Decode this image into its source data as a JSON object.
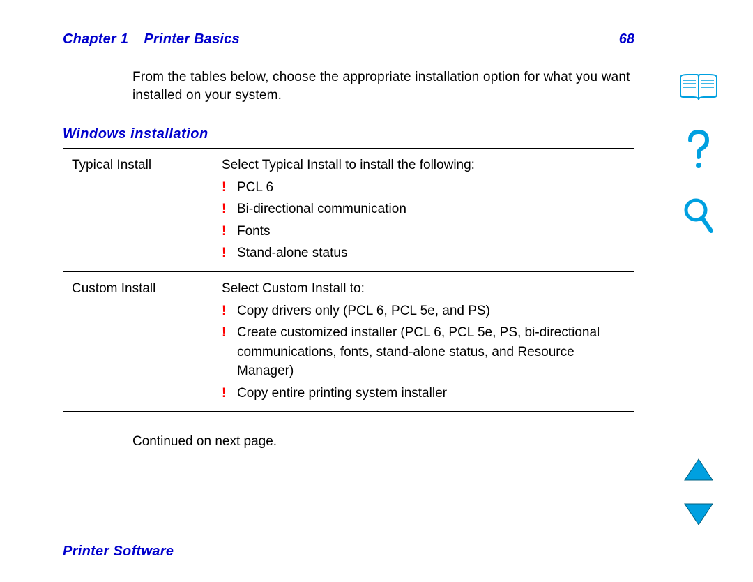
{
  "header": {
    "chapter_label": "Chapter 1",
    "chapter_title": "Printer Basics",
    "page_number": "68"
  },
  "intro": "From the tables below, choose the appropriate installation option for what you want installed on your system.",
  "section_heading": "Windows installation",
  "table": {
    "rows": [
      {
        "left": "Typical Install",
        "lead": "Select Typical Install  to install the following:",
        "bullets": [
          "PCL 6",
          "Bi-directional communication",
          "Fonts",
          "Stand-alone status"
        ]
      },
      {
        "left": "Custom Install",
        "lead": "Select Custom Install  to:",
        "bullets": [
          "Copy drivers only (PCL 6, PCL 5e, and PS)",
          "Create customized installer (PCL 6, PCL 5e, PS, bi-directional communications, fonts, stand-alone status, and Resource Manager)",
          "Copy entire printing system installer"
        ]
      }
    ]
  },
  "continued": "Continued on next page.",
  "footer": "Printer Software",
  "bullet_char": "!"
}
